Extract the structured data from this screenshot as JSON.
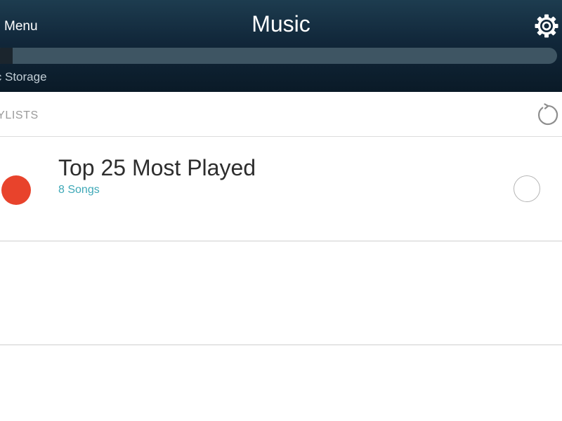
{
  "header": {
    "menu_label": "Menu",
    "title": "Music",
    "settings_icon": "gear-icon",
    "storage": {
      "label": "ic Storage",
      "used_fraction": 0.035
    }
  },
  "section": {
    "label": "AYLISTS",
    "refresh_icon": "refresh-icon"
  },
  "playlists": [
    {
      "title": "Top 25 Most Played",
      "subtitle": "8 Songs",
      "dot_color": "#e8432c",
      "selected": false
    }
  ],
  "colors": {
    "header_dark": "#0a1a27",
    "accent_teal": "#3ea8b7",
    "playlist_dot": "#e8432c"
  }
}
